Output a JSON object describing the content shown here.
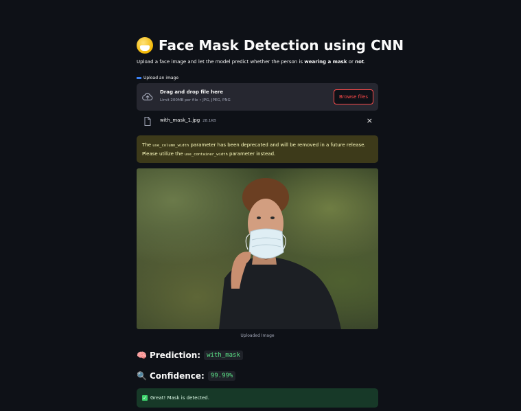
{
  "app": {
    "title": "Face Mask Detection using CNN",
    "subtitle_prefix": "Upload a face image and let the model predict whether the person is ",
    "subtitle_bold1": "wearing a mask",
    "subtitle_mid": " or ",
    "subtitle_bold2": "not",
    "subtitle_end": "."
  },
  "uploader": {
    "label": "Upload an image",
    "drop_title": "Drag and drop file here",
    "drop_limit": "Limit 200MB per file • JPG, JPEG, PNG",
    "browse_label": "Browse files",
    "file_name": "with_mask_1.jpg",
    "file_size": "28.1KB",
    "close_glyph": "×"
  },
  "warning": {
    "text_start": "The ",
    "code1": "use_column_width",
    "text_mid": " parameter has been deprecated and will be removed in a future release. Please utilize the ",
    "code2": "use_container_width",
    "text_end": " parameter instead."
  },
  "image": {
    "caption": "Uploaded Image"
  },
  "results": {
    "prediction_icon": "🧠",
    "prediction_label": "Prediction:",
    "prediction_value": "with_mask",
    "confidence_icon": "🔍",
    "confidence_label": "Confidence:",
    "confidence_value": "99.99%"
  },
  "success": {
    "message": "Great! Mask is detected."
  },
  "colors": {
    "background": "#0e1117",
    "accent": "#ff4b4b",
    "warning_bg": "#3d3a1a",
    "success_bg": "#173928",
    "code_green": "#5ce488"
  }
}
